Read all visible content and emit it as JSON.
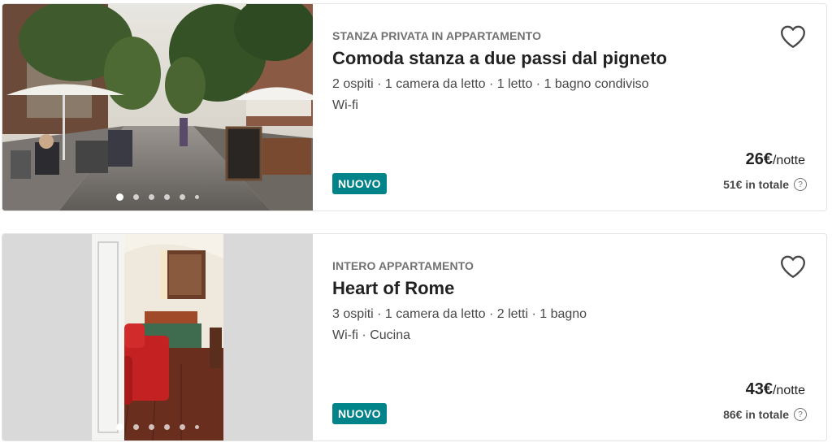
{
  "colors": {
    "badge": "#008489",
    "heart_stroke": "#484848"
  },
  "listings": [
    {
      "type": "STANZA PRIVATA IN APPARTAMENTO",
      "title": "Comoda stanza a due passi dal pigneto",
      "details": "2 ospiti · 1 camera da letto · 1 letto · 1 bagno condiviso",
      "amenities": "Wi-fi",
      "badge": "NUOVO",
      "price": "26€",
      "price_unit": "/notte",
      "total": "51€ in totale",
      "help_icon": "?",
      "photo_count": 6,
      "active_photo": 1
    },
    {
      "type": "INTERO APPARTAMENTO",
      "title": "Heart of Rome",
      "details": "3 ospiti · 1 camera da letto · 2 letti · 1 bagno",
      "amenities": "Wi-fi · Cucina",
      "badge": "NUOVO",
      "price": "43€",
      "price_unit": "/notte",
      "total": "86€ in totale",
      "help_icon": "?",
      "photo_count": 6,
      "active_photo": 1
    }
  ]
}
